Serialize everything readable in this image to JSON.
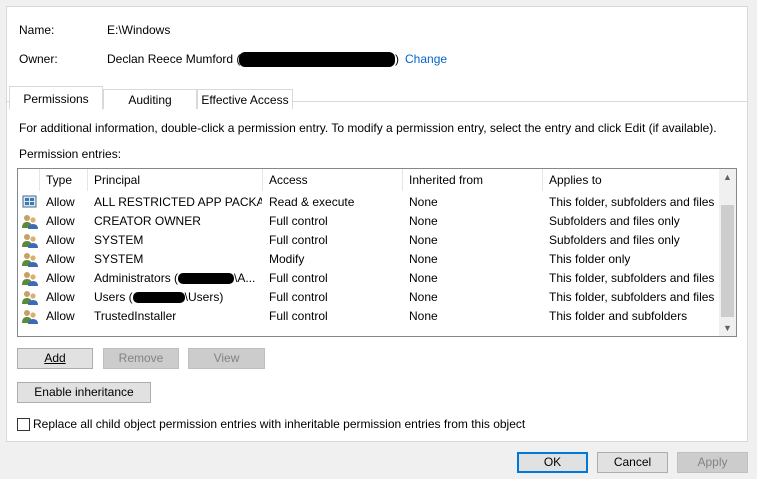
{
  "header": {
    "name_label": "Name:",
    "name_value": "E:\\Windows",
    "owner_label": "Owner:",
    "owner_value": "Declan Reece Mumford (",
    "owner_close": ")",
    "change_link": "Change"
  },
  "tabs": [
    {
      "label": "Permissions",
      "active": true
    },
    {
      "label": "Auditing",
      "active": false
    },
    {
      "label": "Effective Access",
      "active": false
    }
  ],
  "info_text": "For additional information, double-click a permission entry. To modify a permission entry, select the entry and click Edit (if available).",
  "entries_label": "Permission entries:",
  "columns": [
    "Type",
    "Principal",
    "Access",
    "Inherited from",
    "Applies to"
  ],
  "rows": [
    {
      "icon": "app-package-icon",
      "type": "Allow",
      "principal": "ALL RESTRICTED APP PACKA...",
      "access": "Read & execute",
      "inherited": "None",
      "applies": "This folder, subfolders and files"
    },
    {
      "icon": "users-group-icon",
      "type": "Allow",
      "principal": "CREATOR OWNER",
      "access": "Full control",
      "inherited": "None",
      "applies": "Subfolders and files only"
    },
    {
      "icon": "users-group-icon",
      "type": "Allow",
      "principal": "SYSTEM",
      "access": "Full control",
      "inherited": "None",
      "applies": "Subfolders and files only"
    },
    {
      "icon": "users-group-icon",
      "type": "Allow",
      "principal": "SYSTEM",
      "access": "Modify",
      "inherited": "None",
      "applies": "This folder only"
    },
    {
      "icon": "users-group-icon",
      "type": "Allow",
      "principal": "Administrators (",
      "principal_tail": "\\A...",
      "access": "Full control",
      "inherited": "None",
      "applies": "This folder, subfolders and files"
    },
    {
      "icon": "users-group-icon",
      "type": "Allow",
      "principal": "Users (",
      "principal_tail": "\\Users)",
      "access": "Full control",
      "inherited": "None",
      "applies": "This folder, subfolders and files"
    },
    {
      "icon": "users-group-icon",
      "type": "Allow",
      "principal": "TrustedInstaller",
      "access": "Full control",
      "inherited": "None",
      "applies": "This folder and subfolders"
    }
  ],
  "buttons": {
    "add": "Add",
    "remove": "Remove",
    "view": "View",
    "enable_inheritance": "Enable inheritance",
    "ok": "OK",
    "cancel": "Cancel",
    "apply": "Apply"
  },
  "replace_checkbox": {
    "label": "Replace all child object permission entries with inheritable permission entries from this object",
    "checked": false
  },
  "colors": {
    "link": "#0066cc",
    "focus": "#0078d7"
  }
}
